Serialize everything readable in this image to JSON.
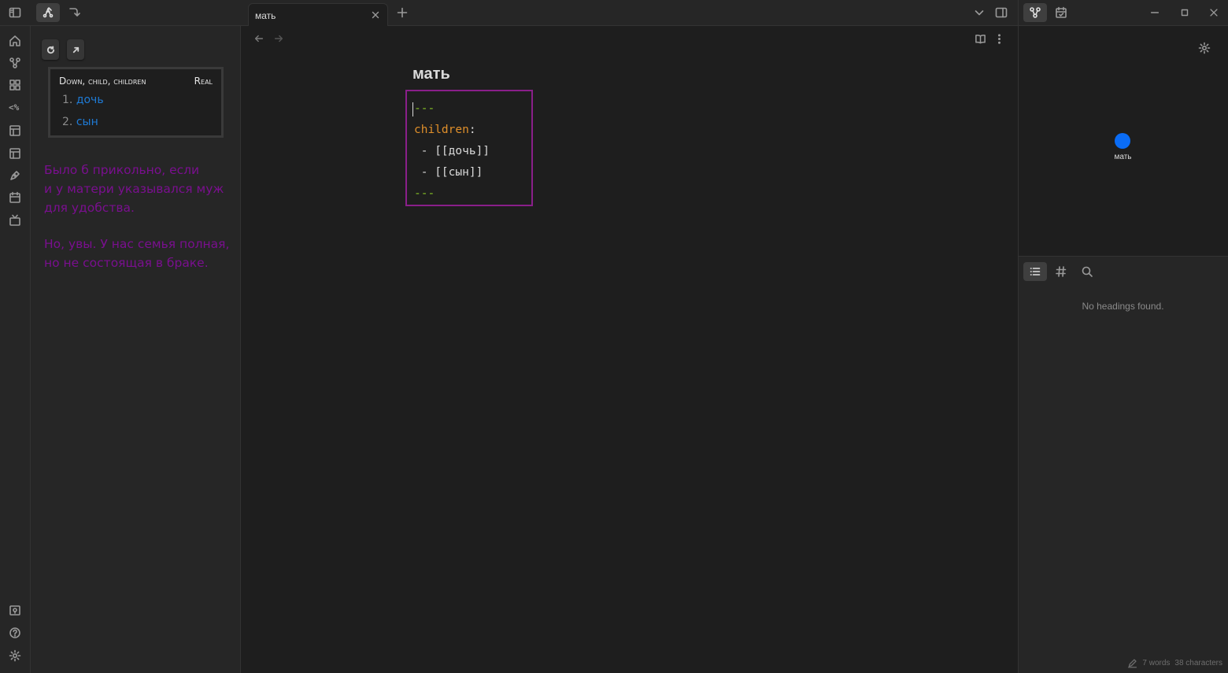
{
  "tab": {
    "title": "мать"
  },
  "breadcrumbs": {
    "field_label": "Down, child, children",
    "real_label": "Real",
    "items": [
      {
        "num": "1.",
        "name": "дочь"
      },
      {
        "num": "2.",
        "name": "сын"
      }
    ]
  },
  "sidebar_note": {
    "paragraph1": [
      "Было б прикольно, если",
      "и у матери указывался муж",
      "для удобства."
    ],
    "paragraph2": [
      "Но, увы. У нас семья полная,",
      "но не состоящая в браке."
    ]
  },
  "editor": {
    "title": "мать",
    "frontmatter": {
      "fence": "---",
      "key": "children",
      "colon": ":",
      "items": [
        " - [[дочь]]",
        " - [[сын]]"
      ],
      "fence_end": "---"
    }
  },
  "graph": {
    "node_label": "мать"
  },
  "outline": {
    "empty_text": "No headings found."
  },
  "status": {
    "words": "7 words",
    "characters": "38 characters"
  },
  "colors": {
    "accent": "#0a6cf5",
    "link": "#1e7bd6",
    "annotation_purple": "#7a0f8f",
    "frontmatter_border": "#8a1f8a",
    "yaml_key": "#e08f2a",
    "yaml_fence": "#86c226"
  }
}
